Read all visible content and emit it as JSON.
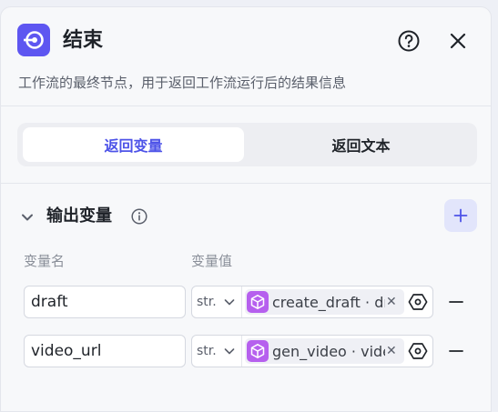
{
  "header": {
    "title": "结束",
    "description": "工作流的最终节点，用于返回工作流运行后的结果信息",
    "logo_icon": "end-node-icon",
    "help_icon": "help-icon",
    "close_icon": "close-icon",
    "accent_color": "#5e56f1"
  },
  "tabs": [
    {
      "label": "返回变量",
      "active": true
    },
    {
      "label": "返回文本",
      "active": false
    }
  ],
  "output": {
    "title": "输出变量",
    "columns": {
      "name": "变量名",
      "value": "变量值"
    },
    "rows": [
      {
        "name": "draft",
        "type": "str.",
        "ref": "create_draft · draft_url"
      },
      {
        "name": "video_url",
        "type": "str.",
        "ref": "gen_video · video_url"
      }
    ]
  }
}
